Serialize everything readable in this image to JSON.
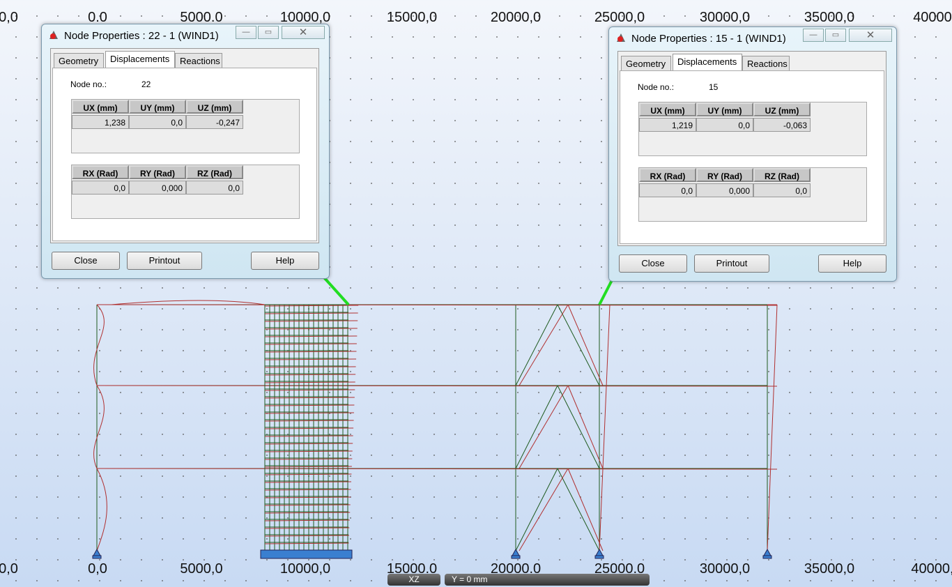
{
  "axis": {
    "top": [
      "0,0",
      "0.0",
      "5000.0",
      "10000,0",
      "15000,0",
      "20000,0",
      "25000,0",
      "30000,0",
      "35000,0",
      "40000"
    ],
    "bottom": [
      "0,0",
      "0,0",
      "5000,0",
      "10000,0",
      "15000.0",
      "20000.0",
      "25000.0",
      "30000,0",
      "35000,0",
      "40000,"
    ]
  },
  "dialogs": [
    {
      "title": "Node Properties : 22 - 1 (WIND1)",
      "tabs": [
        "Geometry",
        "Displacements",
        "Reactions"
      ],
      "active_tab": "Displacements",
      "node_label": "Node no.:",
      "node": "22",
      "disp_headers": [
        "UX (mm)",
        "UY (mm)",
        "UZ (mm)"
      ],
      "disp_values": [
        "1,238",
        "0,0",
        "-0,247"
      ],
      "rot_headers": [
        "RX (Rad)",
        "RY (Rad)",
        "RZ (Rad)"
      ],
      "rot_values": [
        "0,0",
        "0,000",
        "0,0"
      ],
      "buttons": [
        "Close",
        "Printout",
        "Help"
      ]
    },
    {
      "title": "Node Properties : 15 - 1 (WIND1)",
      "tabs": [
        "Geometry",
        "Displacements",
        "Reactions"
      ],
      "active_tab": "Displacements",
      "node_label": "Node no.:",
      "node": "15",
      "disp_headers": [
        "UX (mm)",
        "UY (mm)",
        "UZ (mm)"
      ],
      "disp_values": [
        "1,219",
        "0,0",
        "-0,063"
      ],
      "rot_headers": [
        "RX (Rad)",
        "RY (Rad)",
        "RZ (Rad)"
      ],
      "rot_values": [
        "0,0",
        "0,000",
        "0,0"
      ],
      "buttons": [
        "Close",
        "Printout",
        "Help"
      ]
    }
  ],
  "status": {
    "view": "XZ",
    "plane": "Y = 0 mm"
  },
  "colors": {
    "structure": "#1e5a1e",
    "deformed": "#b03030",
    "leader": "#22dd22",
    "support": "#3a7fd0"
  }
}
